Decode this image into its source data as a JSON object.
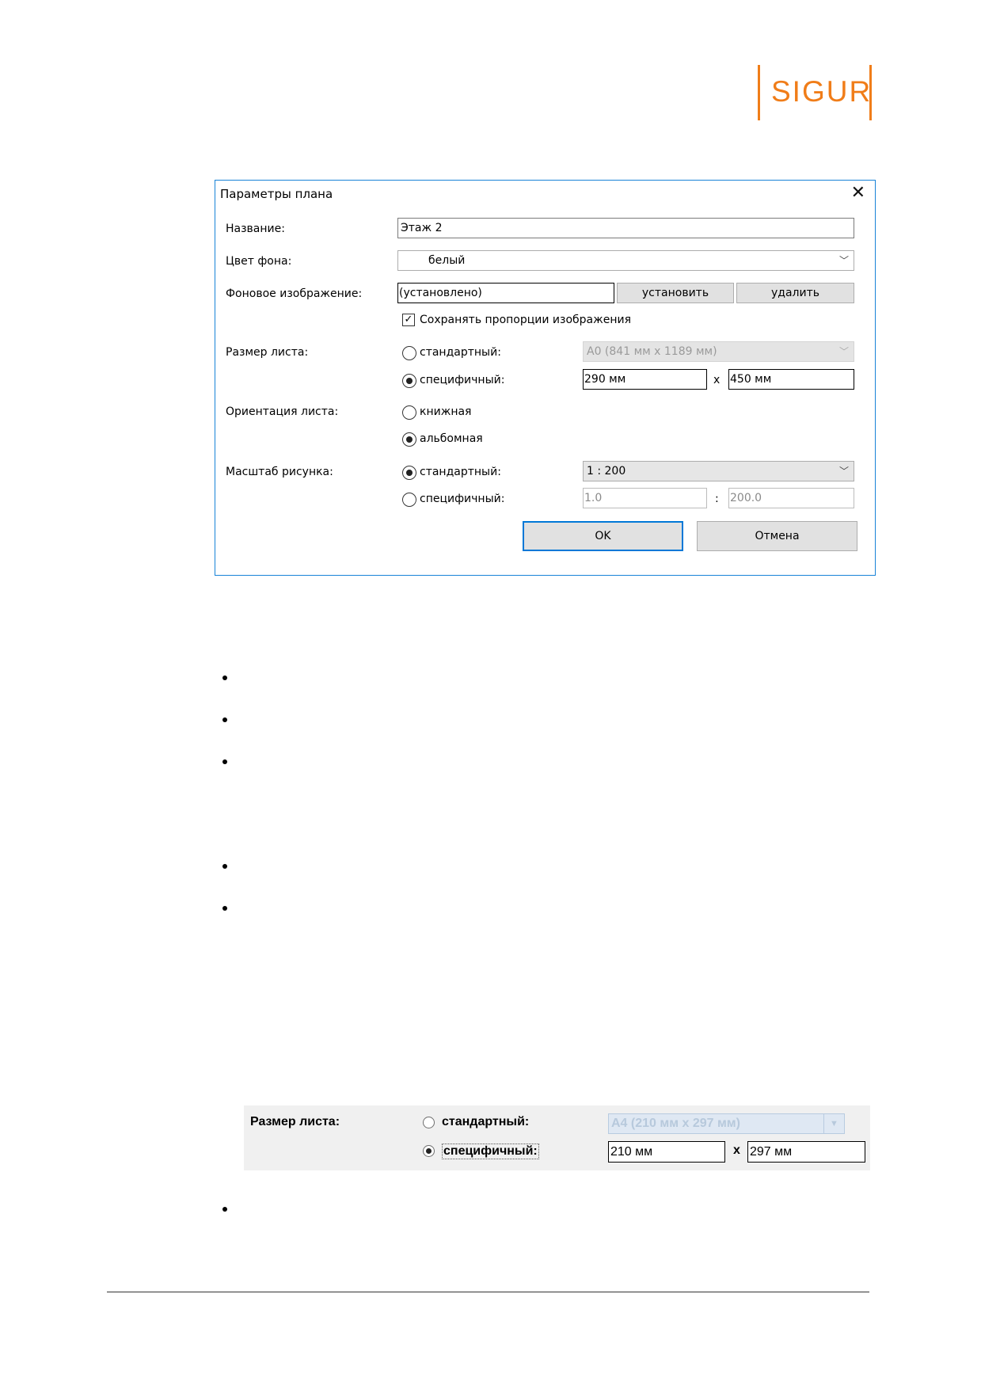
{
  "logo": {
    "text": "SIGUR",
    "color": "#f07d19"
  },
  "dialog": {
    "title": "Параметры плана",
    "name_label": "Название:",
    "name_value": "Этаж 2",
    "bg_color_label": "Цвет фона:",
    "bg_color_value": "белый",
    "bg_image_label": "Фоновое изображение:",
    "bg_image_value": "(установлено)",
    "set_button": "установить",
    "delete_button": "удалить",
    "keep_proportions": "Сохранять пропорции изображения",
    "sheet_size_label": "Размер листа:",
    "sheet_standard": "стандартный:",
    "sheet_standard_value": "A0 (841 мм x 1189 мм)",
    "sheet_custom": "специфичный:",
    "sheet_width": "290 мм",
    "sheet_x": "x",
    "sheet_height": "450 мм",
    "orientation_label": "Ориентация листа:",
    "portrait": "книжная",
    "landscape": "альбомная",
    "scale_label": "Масштаб рисунка:",
    "scale_standard": "стандартный:",
    "scale_standard_value": "1 : 200",
    "scale_custom": "специфичный:",
    "scale_a": "1.0",
    "scale_colon": ":",
    "scale_b": "200.0",
    "ok_button": "OK",
    "cancel_button": "Отмена"
  },
  "panel": {
    "label": "Размер листа:",
    "standard": "стандартный:",
    "standard_value": "A4 (210 мм x 297 мм)",
    "custom": "специфичный:",
    "width": "210 мм",
    "x": "x",
    "height": "297 мм"
  }
}
